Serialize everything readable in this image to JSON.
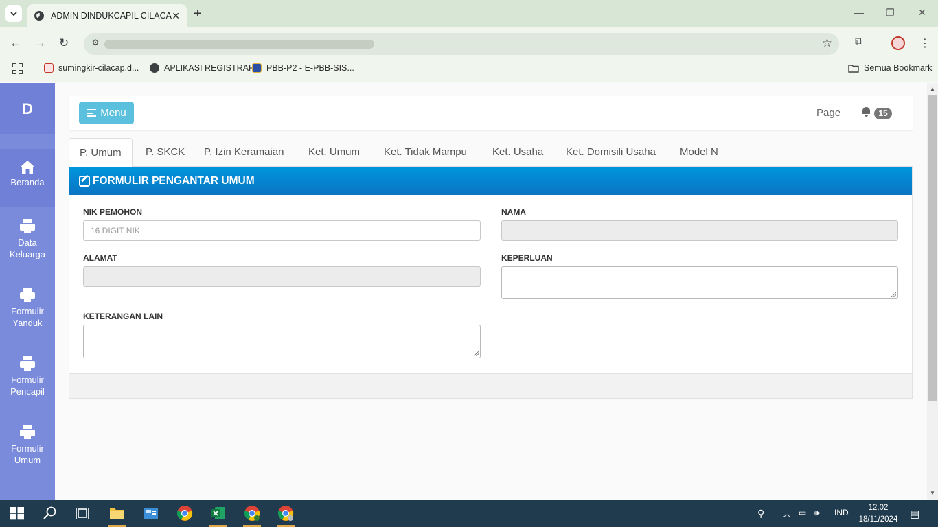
{
  "browser": {
    "tab_title": "ADMIN DINDUKCAPIL CILACAP",
    "tab_close": "✕",
    "new_tab": "+",
    "window_controls": {
      "minimize": "—",
      "restore": "❐",
      "close": "✕"
    },
    "bookmarks": [
      {
        "label": "sumingkir-cilacap.d...",
        "icon": "shield-icon"
      },
      {
        "label": "APLIKASI REGISTRAR",
        "icon": "globe-icon"
      },
      {
        "label": "PBB-P2 - E-PBB-SIS...",
        "icon": "emblem-icon"
      }
    ],
    "all_bookmarks": "Semua Bookmark"
  },
  "app": {
    "brand": "D",
    "sidebar": [
      {
        "label_1": "Beranda",
        "label_2": "",
        "icon": "home-icon",
        "active": true
      },
      {
        "label_1": "Data",
        "label_2": "Keluarga",
        "icon": "printer-icon"
      },
      {
        "label_1": "Formulir",
        "label_2": "Yanduk",
        "icon": "printer-icon"
      },
      {
        "label_1": "Formulir",
        "label_2": "Pencapil",
        "icon": "printer-icon"
      },
      {
        "label_1": "Formulir",
        "label_2": "Umum",
        "icon": "printer-icon"
      }
    ],
    "topbar": {
      "menu_label": "Menu",
      "page_label": "Page",
      "notification_count": "15"
    },
    "tabs": [
      "P. Umum",
      "P. SKCK",
      "P. Izin Keramaian",
      "Ket. Umum",
      "Ket. Tidak Mampu",
      "Ket. Usaha",
      "Ket. Domisili Usaha",
      "Model N"
    ],
    "form": {
      "title": "FORMULIR PENGANTAR UMUM",
      "nik_label": "NIK PEMOHON",
      "nik_placeholder": "16 DIGIT NIK",
      "nama_label": "NAMA",
      "alamat_label": "ALAMAT",
      "keperluan_label": "KEPERLUAN",
      "keterangan_label": "KETERANGAN LAIN"
    }
  },
  "taskbar": {
    "language": "IND",
    "time": "12.02",
    "date": "18/11/2024"
  }
}
